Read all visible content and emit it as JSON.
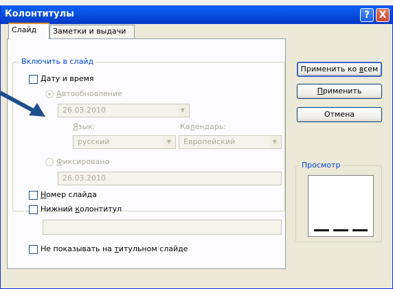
{
  "dialog": {
    "title": "Колонтитулы",
    "help_glyph": "?",
    "close_glyph": "X"
  },
  "tabs": [
    {
      "label": "Слайд",
      "active": true
    },
    {
      "label": "Заметки и выдачи",
      "active": false
    }
  ],
  "include_group": {
    "label": "Включить в слайд",
    "date_time": {
      "label_u": "Д",
      "label_rest": "ату и время",
      "checked": false
    },
    "auto_update": {
      "label_u": "А",
      "label_rest": "втообновление",
      "selected": true,
      "enabled": false
    },
    "auto_date_value": "26.03.2010",
    "language": {
      "label_u": "Я",
      "label_rest": "зык:",
      "value": "русский"
    },
    "calendar": {
      "label_pre": "Ка",
      "label_u": "л",
      "label_rest": "ендарь:",
      "value": "Европейский"
    },
    "fixed": {
      "label_u": "Ф",
      "label_rest": "иксировано",
      "selected": false,
      "enabled": false
    },
    "fixed_value": "26.03.2010",
    "slide_number": {
      "label_u": "Н",
      "label_rest": "омер слайда",
      "checked": false
    },
    "footer": {
      "label_pre": "Нижний ",
      "label_u": "к",
      "label_rest": "олонтитул",
      "checked": false,
      "value": ""
    }
  },
  "hide_on_title": {
    "label_pre": "Не показывать на ",
    "label_u": "т",
    "label_rest": "итульном слайде",
    "checked": false
  },
  "buttons": {
    "apply_all": {
      "label_pre": "Применить ко ",
      "label_u": "в",
      "label_rest": "сем"
    },
    "apply": {
      "label_u": "П",
      "label_rest": "рименить"
    },
    "cancel": "Отмена"
  },
  "preview": {
    "label": "Просмотр"
  },
  "colors": {
    "titlebar": "#0548d8",
    "group_label": "#0046d5",
    "arrow": "#1f4e8c"
  }
}
